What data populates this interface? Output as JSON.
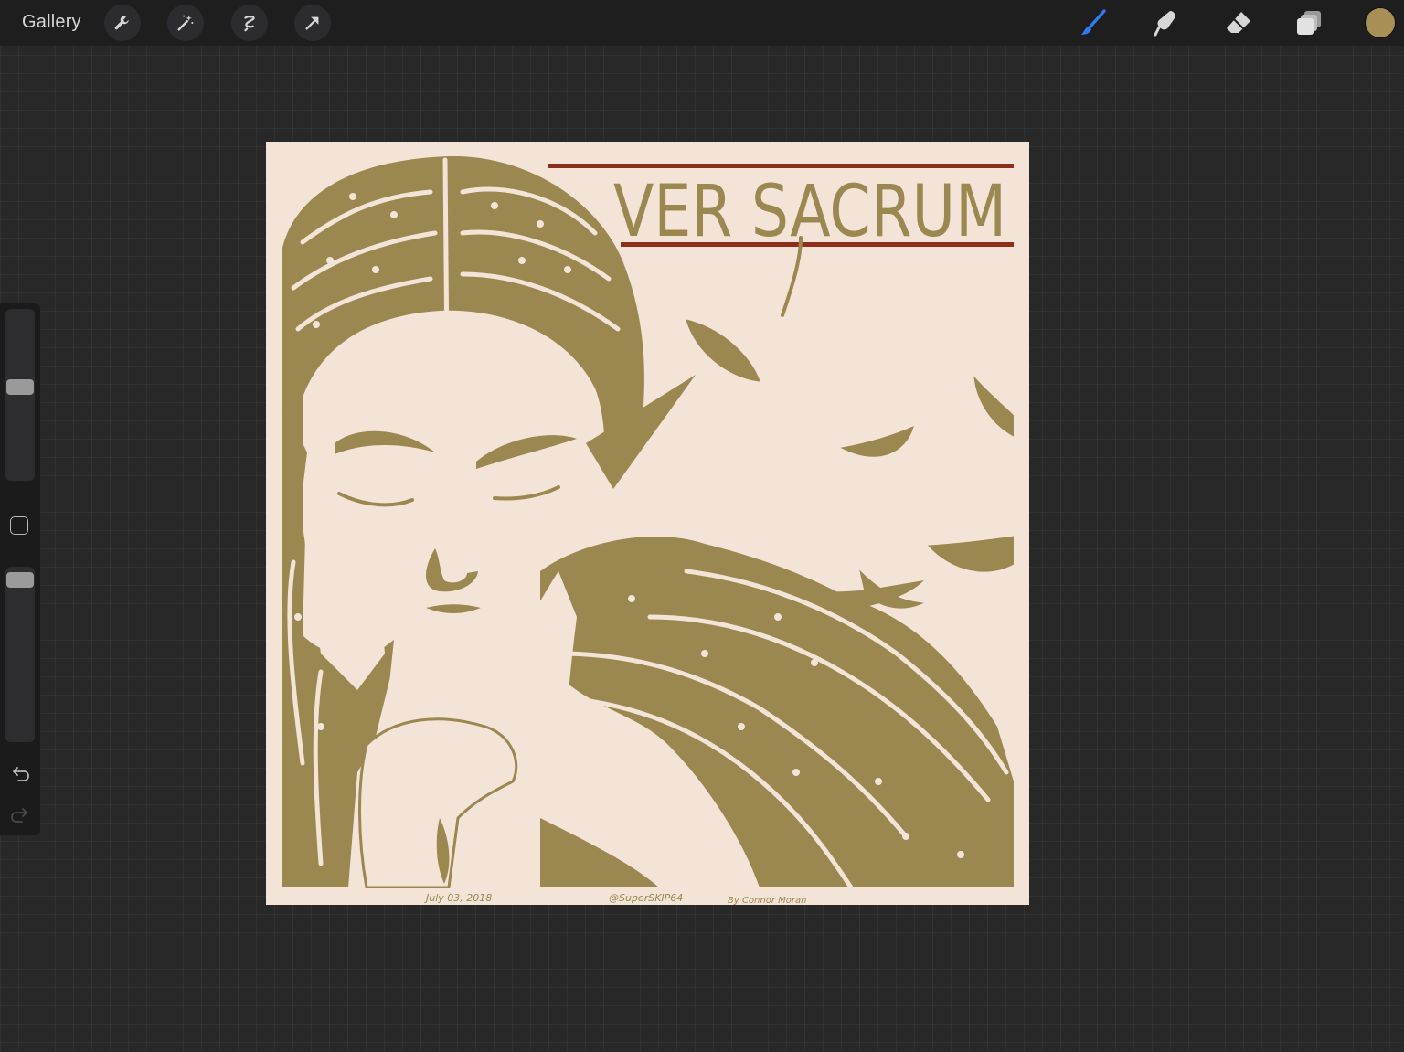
{
  "toolbar": {
    "gallery_label": "Gallery",
    "left_tools": [
      {
        "name": "actions",
        "icon": "wrench-icon"
      },
      {
        "name": "adjustments",
        "icon": "magic-wand-icon"
      },
      {
        "name": "selection",
        "icon": "selection-icon"
      },
      {
        "name": "transform",
        "icon": "arrow-icon"
      }
    ],
    "right_tools": [
      {
        "name": "brush",
        "icon": "brush-icon",
        "active": true
      },
      {
        "name": "smudge",
        "icon": "smudge-icon",
        "active": false
      },
      {
        "name": "eraser",
        "icon": "eraser-icon",
        "active": false
      },
      {
        "name": "layers",
        "icon": "layers-icon",
        "active": false
      }
    ],
    "current_color": "#a88f55"
  },
  "sidebar": {
    "brush_size_level": 0.55,
    "opacity_level": 0.97,
    "modify_icon": "square-icon",
    "undo_icon": "undo-icon",
    "redo_icon": "redo-icon",
    "redo_enabled": false
  },
  "canvas": {
    "colors": {
      "paper": "#f4e4d7",
      "ink": "#9b8750",
      "title_rule": "#8c2f1e"
    },
    "title": "VER SACRUM",
    "date_text": "July 03, 2018",
    "handle_text": "@SuperSKIP64",
    "credit_text": "By Connor Moran"
  }
}
